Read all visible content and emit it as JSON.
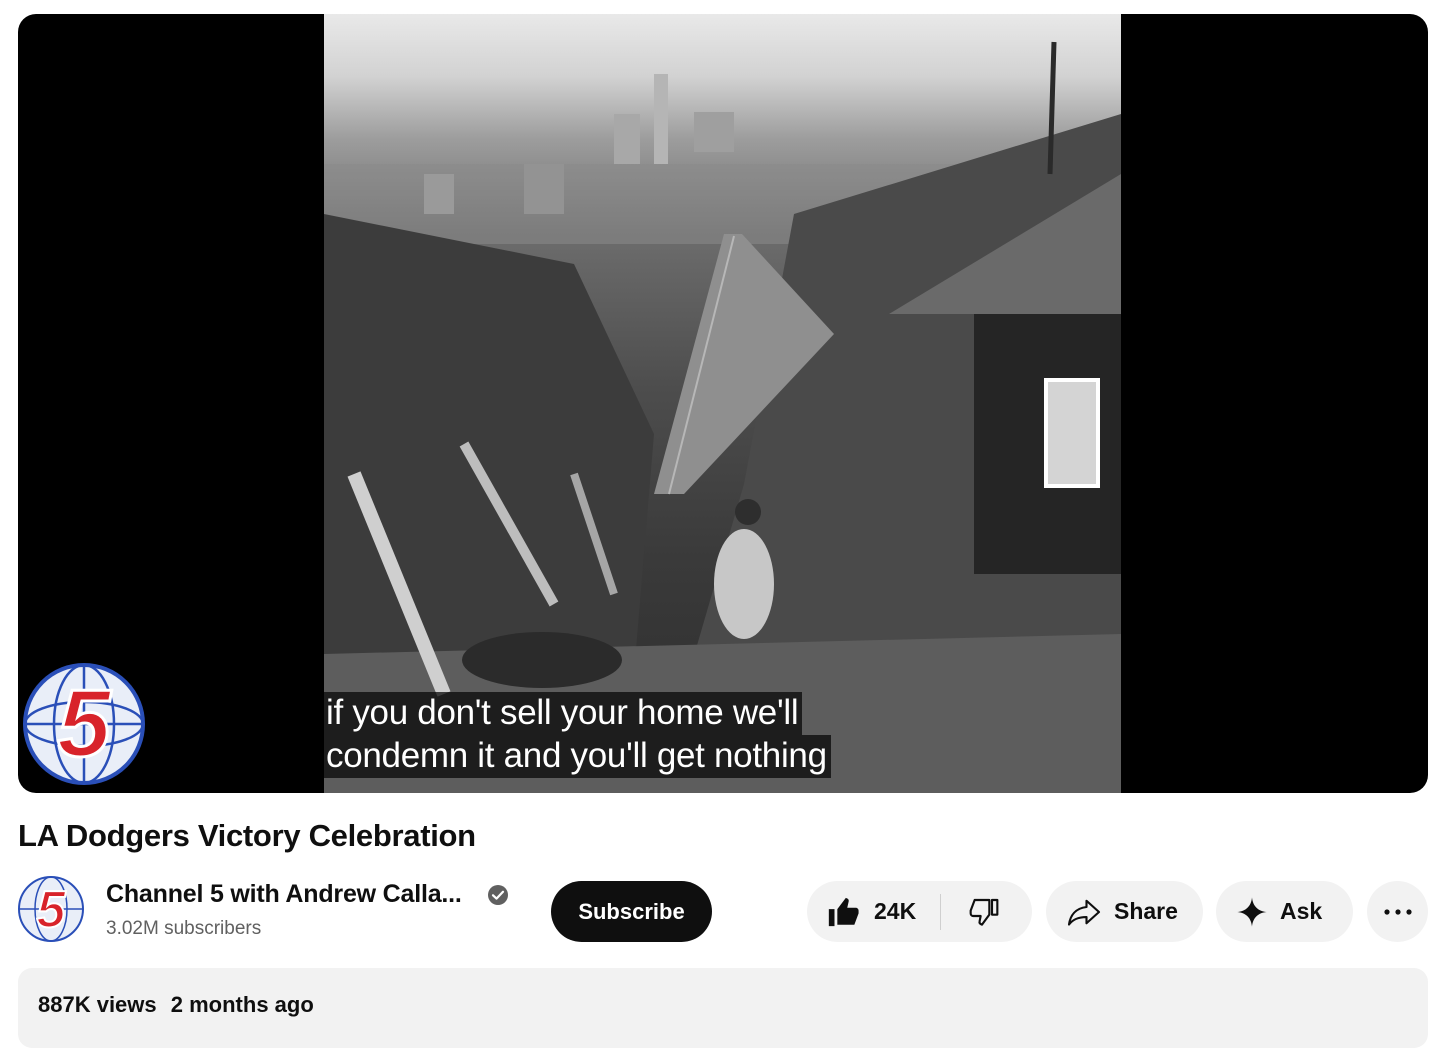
{
  "video": {
    "captions": [
      "if you don't sell your home we'll",
      "condemn it and you'll get nothing"
    ],
    "channel_bug_text": "5"
  },
  "title": "LA Dodgers Victory Celebration",
  "owner": {
    "channel_name": "Channel 5 with Andrew Calla...",
    "subscribers": "3.02M subscribers",
    "subscribe_label": "Subscribe",
    "avatar_text": "5"
  },
  "actions": {
    "like_count": "24K",
    "share_label": "Share",
    "ask_label": "Ask"
  },
  "description": {
    "views": "887K views",
    "date": "2 months ago"
  },
  "icons": {
    "like": "thumb-up-icon",
    "dislike": "thumb-down-icon",
    "share": "share-arrow-icon",
    "ask": "sparkle-icon",
    "more": "more-horizontal-icon",
    "verified": "verified-check-icon"
  },
  "colors": {
    "subscribe_bg": "#0f0f0f",
    "pill_bg": "#f2f2f2",
    "logo_red": "#d8232a",
    "logo_blue": "#2a4fb8"
  }
}
